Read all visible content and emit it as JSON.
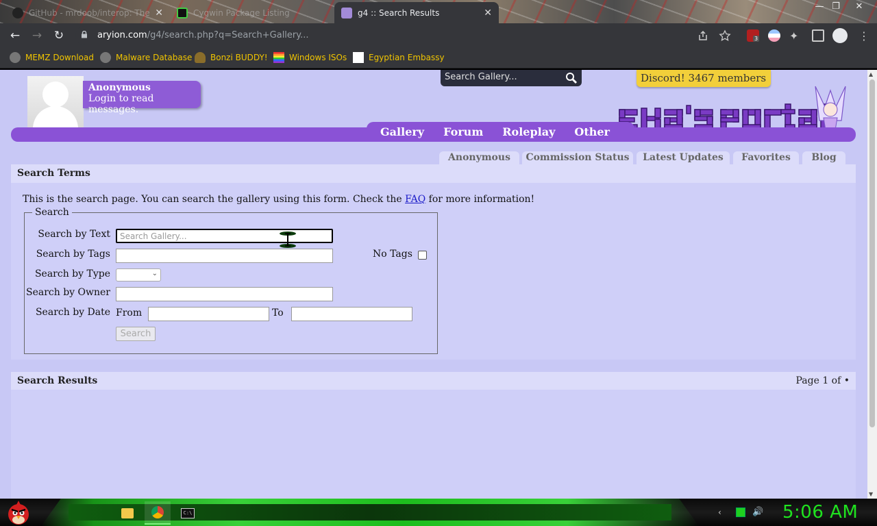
{
  "browser": {
    "tabs": [
      {
        "title": "GitHub - mrdoob/interop: The In...",
        "active": false
      },
      {
        "title": "Cygwin Package Listing",
        "active": false
      },
      {
        "title": "g4 :: Search Results",
        "active": true
      }
    ],
    "url_host": "aryion.com",
    "url_path": "/g4/search.php?q=Search+Gallery...",
    "extension_badge": "3",
    "bookmarks": [
      "MEMZ Download",
      "Malware Database",
      "Bonzi BUDDY!",
      "Windows ISOs",
      "Egyptian Embassy"
    ]
  },
  "site": {
    "user": {
      "name": "Anonymous",
      "message": "Login to read messages."
    },
    "header_search_placeholder": "Search Gallery...",
    "discord": "Discord! 3467 members",
    "nav": [
      "Gallery",
      "Forum",
      "Roleplay",
      "Other"
    ],
    "subnav": [
      "Anonymous",
      "Commission Status",
      "Latest Updates",
      "Favorites",
      "Blog"
    ]
  },
  "search_terms": {
    "heading": "Search Terms",
    "intro_before": "This is the search page. You can search the gallery using this form. Check the",
    "faq_link": "FAQ",
    "intro_after": "for more information!",
    "legend": "Search",
    "label_text": "Search by Text",
    "text_placeholder": "Search Gallery...",
    "label_tags": "Search by Tags",
    "label_notags": "No Tags",
    "label_type": "Search by Type",
    "label_owner": "Search by Owner",
    "label_date": "Search by Date",
    "label_from": "From",
    "label_to": "To",
    "search_button": "Search"
  },
  "search_results": {
    "heading": "Search Results",
    "page_info": "Page 1 of •"
  },
  "taskbar": {
    "clock": "5:06 AM"
  },
  "colors": {
    "page_bg": "#c8c8f5",
    "nav_purple": "#8a52d6",
    "discord_yellow": "#f2cf3a",
    "clock_green": "#1fe31f"
  }
}
